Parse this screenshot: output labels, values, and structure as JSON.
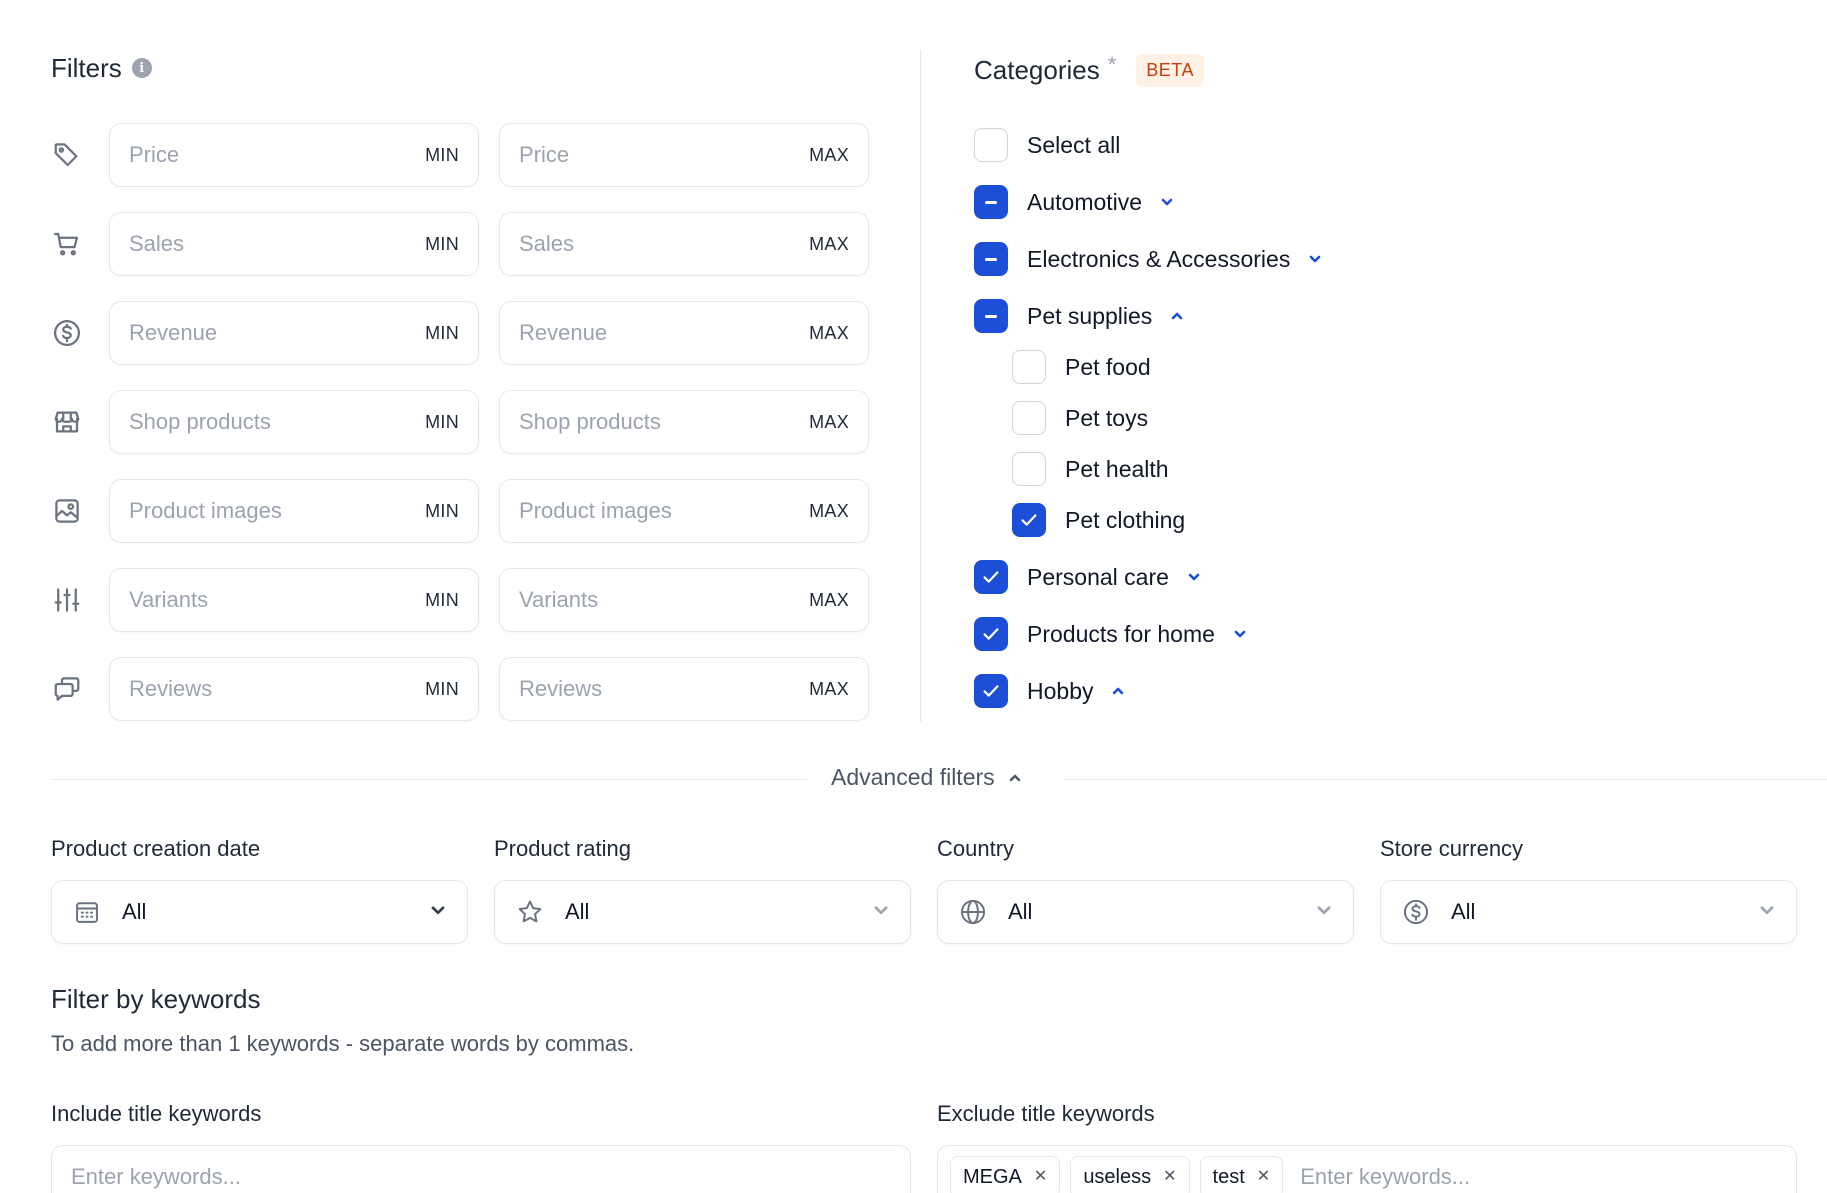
{
  "filters": {
    "title": "Filters",
    "info_glyph": "i",
    "rows": [
      {
        "icon": "price-tag-icon",
        "min_placeholder": "Price",
        "max_placeholder": "Price",
        "min_tag": "MIN",
        "max_tag": "MAX"
      },
      {
        "icon": "cart-icon",
        "min_placeholder": "Sales",
        "max_placeholder": "Sales",
        "min_tag": "MIN",
        "max_tag": "MAX"
      },
      {
        "icon": "dollar-circle-icon",
        "min_placeholder": "Revenue",
        "max_placeholder": "Revenue",
        "min_tag": "MIN",
        "max_tag": "MAX"
      },
      {
        "icon": "store-icon",
        "min_placeholder": "Shop products",
        "max_placeholder": "Shop products",
        "min_tag": "MIN",
        "max_tag": "MAX"
      },
      {
        "icon": "image-icon",
        "min_placeholder": "Product images",
        "max_placeholder": "Product images",
        "min_tag": "MIN",
        "max_tag": "MAX"
      },
      {
        "icon": "sliders-icon",
        "min_placeholder": "Variants",
        "max_placeholder": "Variants",
        "min_tag": "MIN",
        "max_tag": "MAX"
      },
      {
        "icon": "chat-bubbles-icon",
        "min_placeholder": "Reviews",
        "max_placeholder": "Reviews",
        "min_tag": "MIN",
        "max_tag": "MAX"
      }
    ]
  },
  "categories": {
    "title": "Categories",
    "required_mark": "*",
    "badge": "BETA",
    "items": [
      {
        "label": "Select all",
        "state": "unchecked",
        "level": 0,
        "chevron": "none"
      },
      {
        "label": "Automotive",
        "state": "indeterminate",
        "level": 0,
        "chevron": "down"
      },
      {
        "label": "Electronics & Accessories",
        "state": "indeterminate",
        "level": 0,
        "chevron": "down"
      },
      {
        "label": "Pet supplies",
        "state": "indeterminate",
        "level": 0,
        "chevron": "up"
      },
      {
        "label": "Pet food",
        "state": "unchecked",
        "level": 1,
        "chevron": "none"
      },
      {
        "label": "Pet toys",
        "state": "unchecked",
        "level": 1,
        "chevron": "none"
      },
      {
        "label": "Pet health",
        "state": "unchecked",
        "level": 1,
        "chevron": "none"
      },
      {
        "label": "Pet clothing",
        "state": "checked",
        "level": 1,
        "chevron": "none"
      },
      {
        "label": "Personal care",
        "state": "checked",
        "level": 0,
        "chevron": "down"
      },
      {
        "label": "Products for home",
        "state": "checked",
        "level": 0,
        "chevron": "down"
      },
      {
        "label": "Hobby",
        "state": "checked",
        "level": 0,
        "chevron": "up"
      }
    ],
    "accent_color": "#1d4ed8"
  },
  "advanced": {
    "label": "Advanced filters"
  },
  "dropdowns": [
    {
      "label": "Product creation date",
      "value": "All",
      "icon": "calendar-icon"
    },
    {
      "label": "Product rating",
      "value": "All",
      "icon": "star-icon"
    },
    {
      "label": "Country",
      "value": "All",
      "icon": "globe-icon"
    },
    {
      "label": "Store currency",
      "value": "All",
      "icon": "dollar-circle-icon"
    }
  ],
  "keywords": {
    "title": "Filter by keywords",
    "hint": "To add more than 1 keywords - separate words by commas.",
    "include": {
      "label": "Include title keywords",
      "placeholder": "Enter keywords..."
    },
    "exclude": {
      "label": "Exclude title keywords",
      "placeholder": "Enter keywords...",
      "chips": [
        "MEGA",
        "useless",
        "test"
      ]
    },
    "chip_remove_glyph": "✕"
  }
}
